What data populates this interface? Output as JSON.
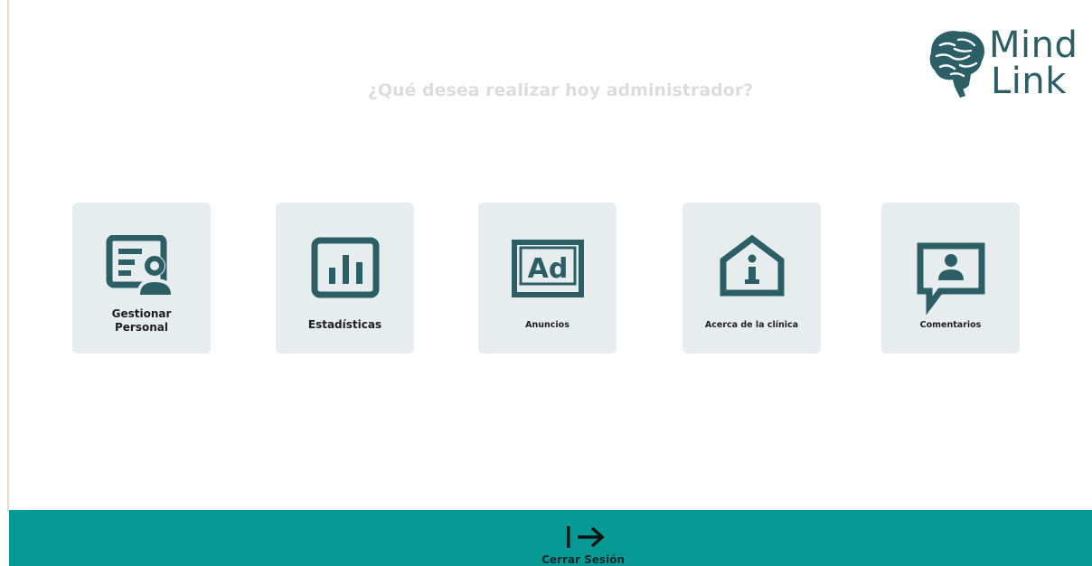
{
  "header": {
    "question": "¿Qué desea realizar hoy administrador?",
    "logo": {
      "line1": "Mind",
      "line2": "Link",
      "icon": "brain-icon"
    }
  },
  "menu": {
    "items": [
      {
        "label": "Gestionar Personal",
        "line1": "Gestionar",
        "line2": "Personal",
        "icon": "staff-management-icon"
      },
      {
        "label": "Estadísticas",
        "icon": "bar-chart-icon"
      },
      {
        "label": "Anuncios",
        "icon": "ad-icon"
      },
      {
        "label": "Acerca de la clínica",
        "icon": "clinic-info-icon"
      },
      {
        "label": "Comentarios",
        "icon": "comment-user-icon"
      }
    ]
  },
  "footer": {
    "logout_label": "Cerrar Sesión",
    "logout_icon": "logout-arrow-icon"
  },
  "colors": {
    "icon": "#2c5f65",
    "card_bg": "#e7ecef",
    "footer_bg": "#079a95",
    "question_text": "#dcdcdc"
  }
}
